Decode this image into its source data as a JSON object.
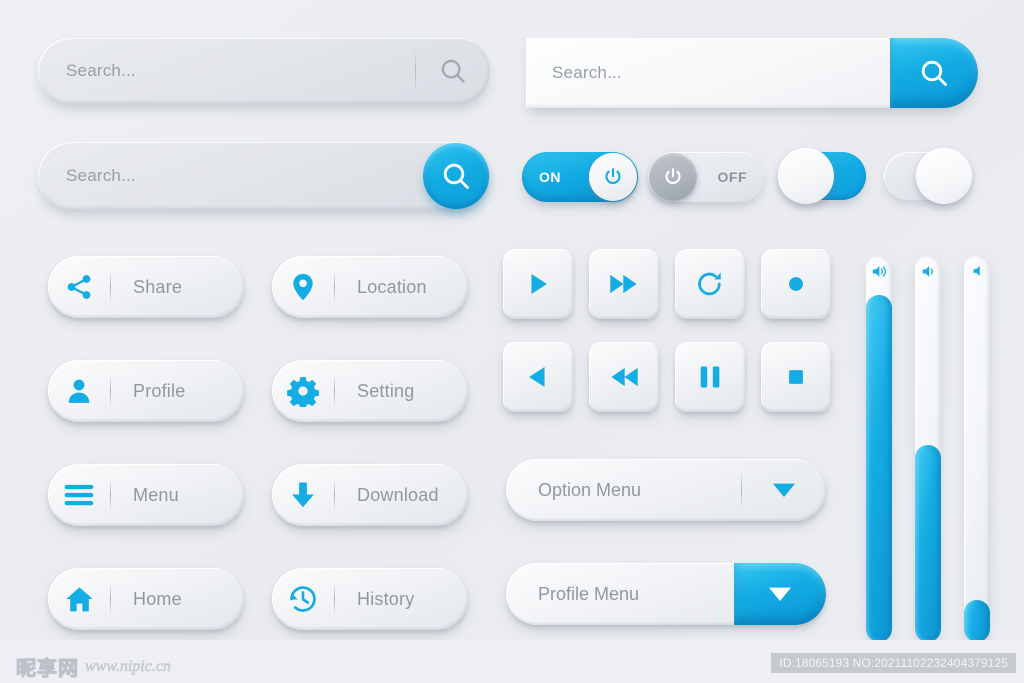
{
  "theme": {
    "background": "#edeff2",
    "accent_blue": "#14ace4",
    "accent_blue_dark": "#0a96d6",
    "surface": "#f2f4f7",
    "text_gray": "#9298a1",
    "placeholder_gray": "#9aa0a8"
  },
  "search_bars": [
    {
      "name": "search-flat",
      "placeholder": "Search...",
      "value": "",
      "icon": "search-icon",
      "icon_style": "gray-divider"
    },
    {
      "name": "search-round-blue",
      "placeholder": "Search...",
      "value": "",
      "icon": "search-icon",
      "icon_style": "blue-circle"
    },
    {
      "name": "search-blue-end",
      "placeholder": "Search...",
      "value": "",
      "icon": "search-icon",
      "icon_style": "blue-pill-end"
    }
  ],
  "toggles": [
    {
      "name": "toggle-on",
      "label": "ON",
      "state": "on",
      "knob": "right",
      "knob_icon": "power-icon",
      "track_color": "#14ace4"
    },
    {
      "name": "toggle-off",
      "label": "OFF",
      "state": "off",
      "knob": "left",
      "knob_icon": "power-icon",
      "track_color": "#e6e9ee"
    },
    {
      "name": "toggle-blue-knob-left",
      "label": "",
      "state": "on",
      "knob": "left",
      "knob_icon": "",
      "track_color": "#14ace4"
    },
    {
      "name": "toggle-gray-knob-right",
      "label": "",
      "state": "off",
      "knob": "right",
      "knob_icon": "",
      "track_color": "#e3e6eb"
    }
  ],
  "pill_buttons": [
    {
      "name": "share-button",
      "label": "Share",
      "icon": "share-icon"
    },
    {
      "name": "location-button",
      "label": "Location",
      "icon": "map-pin-icon"
    },
    {
      "name": "profile-button",
      "label": "Profile",
      "icon": "user-icon"
    },
    {
      "name": "setting-button",
      "label": "Setting",
      "icon": "gear-icon"
    },
    {
      "name": "menu-button",
      "label": "Menu",
      "icon": "hamburger-icon"
    },
    {
      "name": "download-button",
      "label": "Download",
      "icon": "download-arrow-icon"
    },
    {
      "name": "home-button",
      "label": "Home",
      "icon": "home-icon"
    },
    {
      "name": "history-button",
      "label": "History",
      "icon": "history-clock-icon"
    }
  ],
  "media_buttons": [
    {
      "name": "play-button",
      "icon": "play-icon"
    },
    {
      "name": "fast-forward-button",
      "icon": "fast-forward-icon"
    },
    {
      "name": "refresh-button",
      "icon": "refresh-icon"
    },
    {
      "name": "record-button",
      "icon": "record-dot-icon"
    },
    {
      "name": "play-back-button",
      "icon": "play-left-icon"
    },
    {
      "name": "rewind-button",
      "icon": "rewind-icon"
    },
    {
      "name": "pause-button",
      "icon": "pause-icon"
    },
    {
      "name": "stop-button",
      "icon": "stop-square-icon"
    }
  ],
  "dropdowns": [
    {
      "name": "option-menu",
      "label": "Option Menu",
      "arrow": "chevron-down-icon",
      "style": "plain"
    },
    {
      "name": "profile-menu",
      "label": "Profile Menu",
      "arrow": "chevron-down-icon",
      "style": "blue-end"
    }
  ],
  "sliders": [
    {
      "name": "volume-slider-high",
      "icon": "speaker-high-icon",
      "value": 90,
      "min": 0,
      "max": 100
    },
    {
      "name": "volume-slider-medium",
      "icon": "speaker-medium-icon",
      "value": 51,
      "min": 0,
      "max": 100
    },
    {
      "name": "volume-slider-low",
      "icon": "speaker-low-icon",
      "value": 11,
      "min": 0,
      "max": 100
    }
  ],
  "watermark": {
    "site_cjk": "昵享网",
    "site_url": "www.nipic.cn",
    "id_text": "ID:18065193 NO:20211102232404379125"
  }
}
